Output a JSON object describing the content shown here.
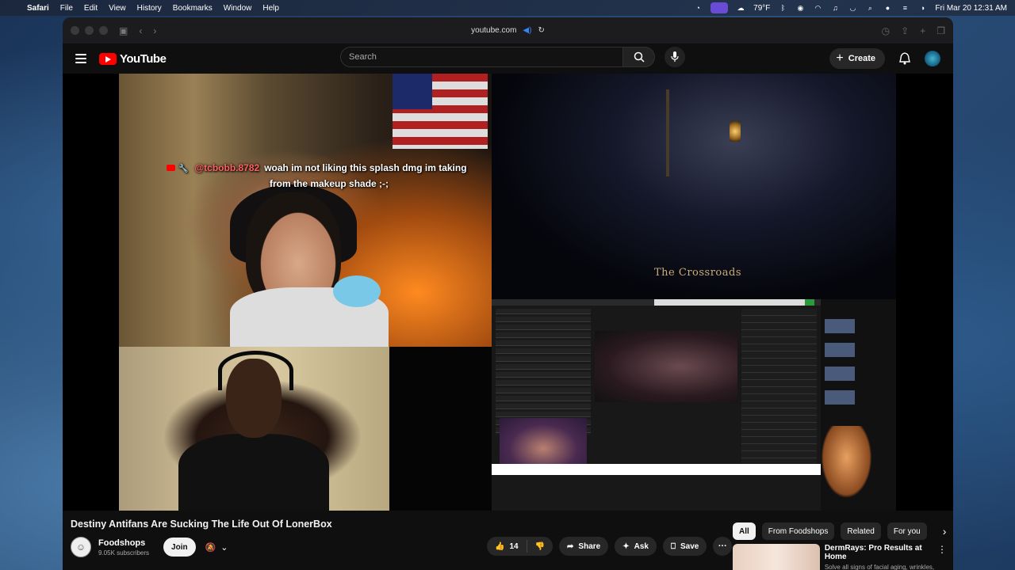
{
  "menubar": {
    "app": "Safari",
    "items": [
      "File",
      "Edit",
      "View",
      "History",
      "Bookmarks",
      "Window",
      "Help"
    ],
    "weather": "79°F",
    "clock": "Fri Mar 20  12:31 AM"
  },
  "browser": {
    "url": "youtube.com"
  },
  "youtube": {
    "logo_text": "YouTube",
    "search_placeholder": "Search",
    "create_label": "Create"
  },
  "video": {
    "chat_user": "@tcbobb.8782",
    "chat_msg_line1": "woah im not liking this splash dmg im taking",
    "chat_msg_line2": "from the makeup shade ;-;",
    "game_caption": "The Crossroads",
    "title": "Destiny Antifans Are Sucking The Life Out Of LonerBox"
  },
  "channel": {
    "name": "Foodshops",
    "subscribers": "9.05K subscribers",
    "join_label": "Join"
  },
  "actions": {
    "likes": "14",
    "share": "Share",
    "ask": "Ask",
    "save": "Save"
  },
  "chips": [
    {
      "label": "All",
      "active": true
    },
    {
      "label": "From Foodshops",
      "active": false
    },
    {
      "label": "Related",
      "active": false
    },
    {
      "label": "For you",
      "active": false
    }
  ],
  "ad": {
    "title": "DermRays: Pro Results at Home",
    "desc": "Solve all signs of facial aging, wrinkles, skin elasticity, texture, tone"
  },
  "colors": {
    "youtube_red": "#ff0000",
    "background": "#0f0f0f",
    "chat_user": "#ff6060"
  }
}
